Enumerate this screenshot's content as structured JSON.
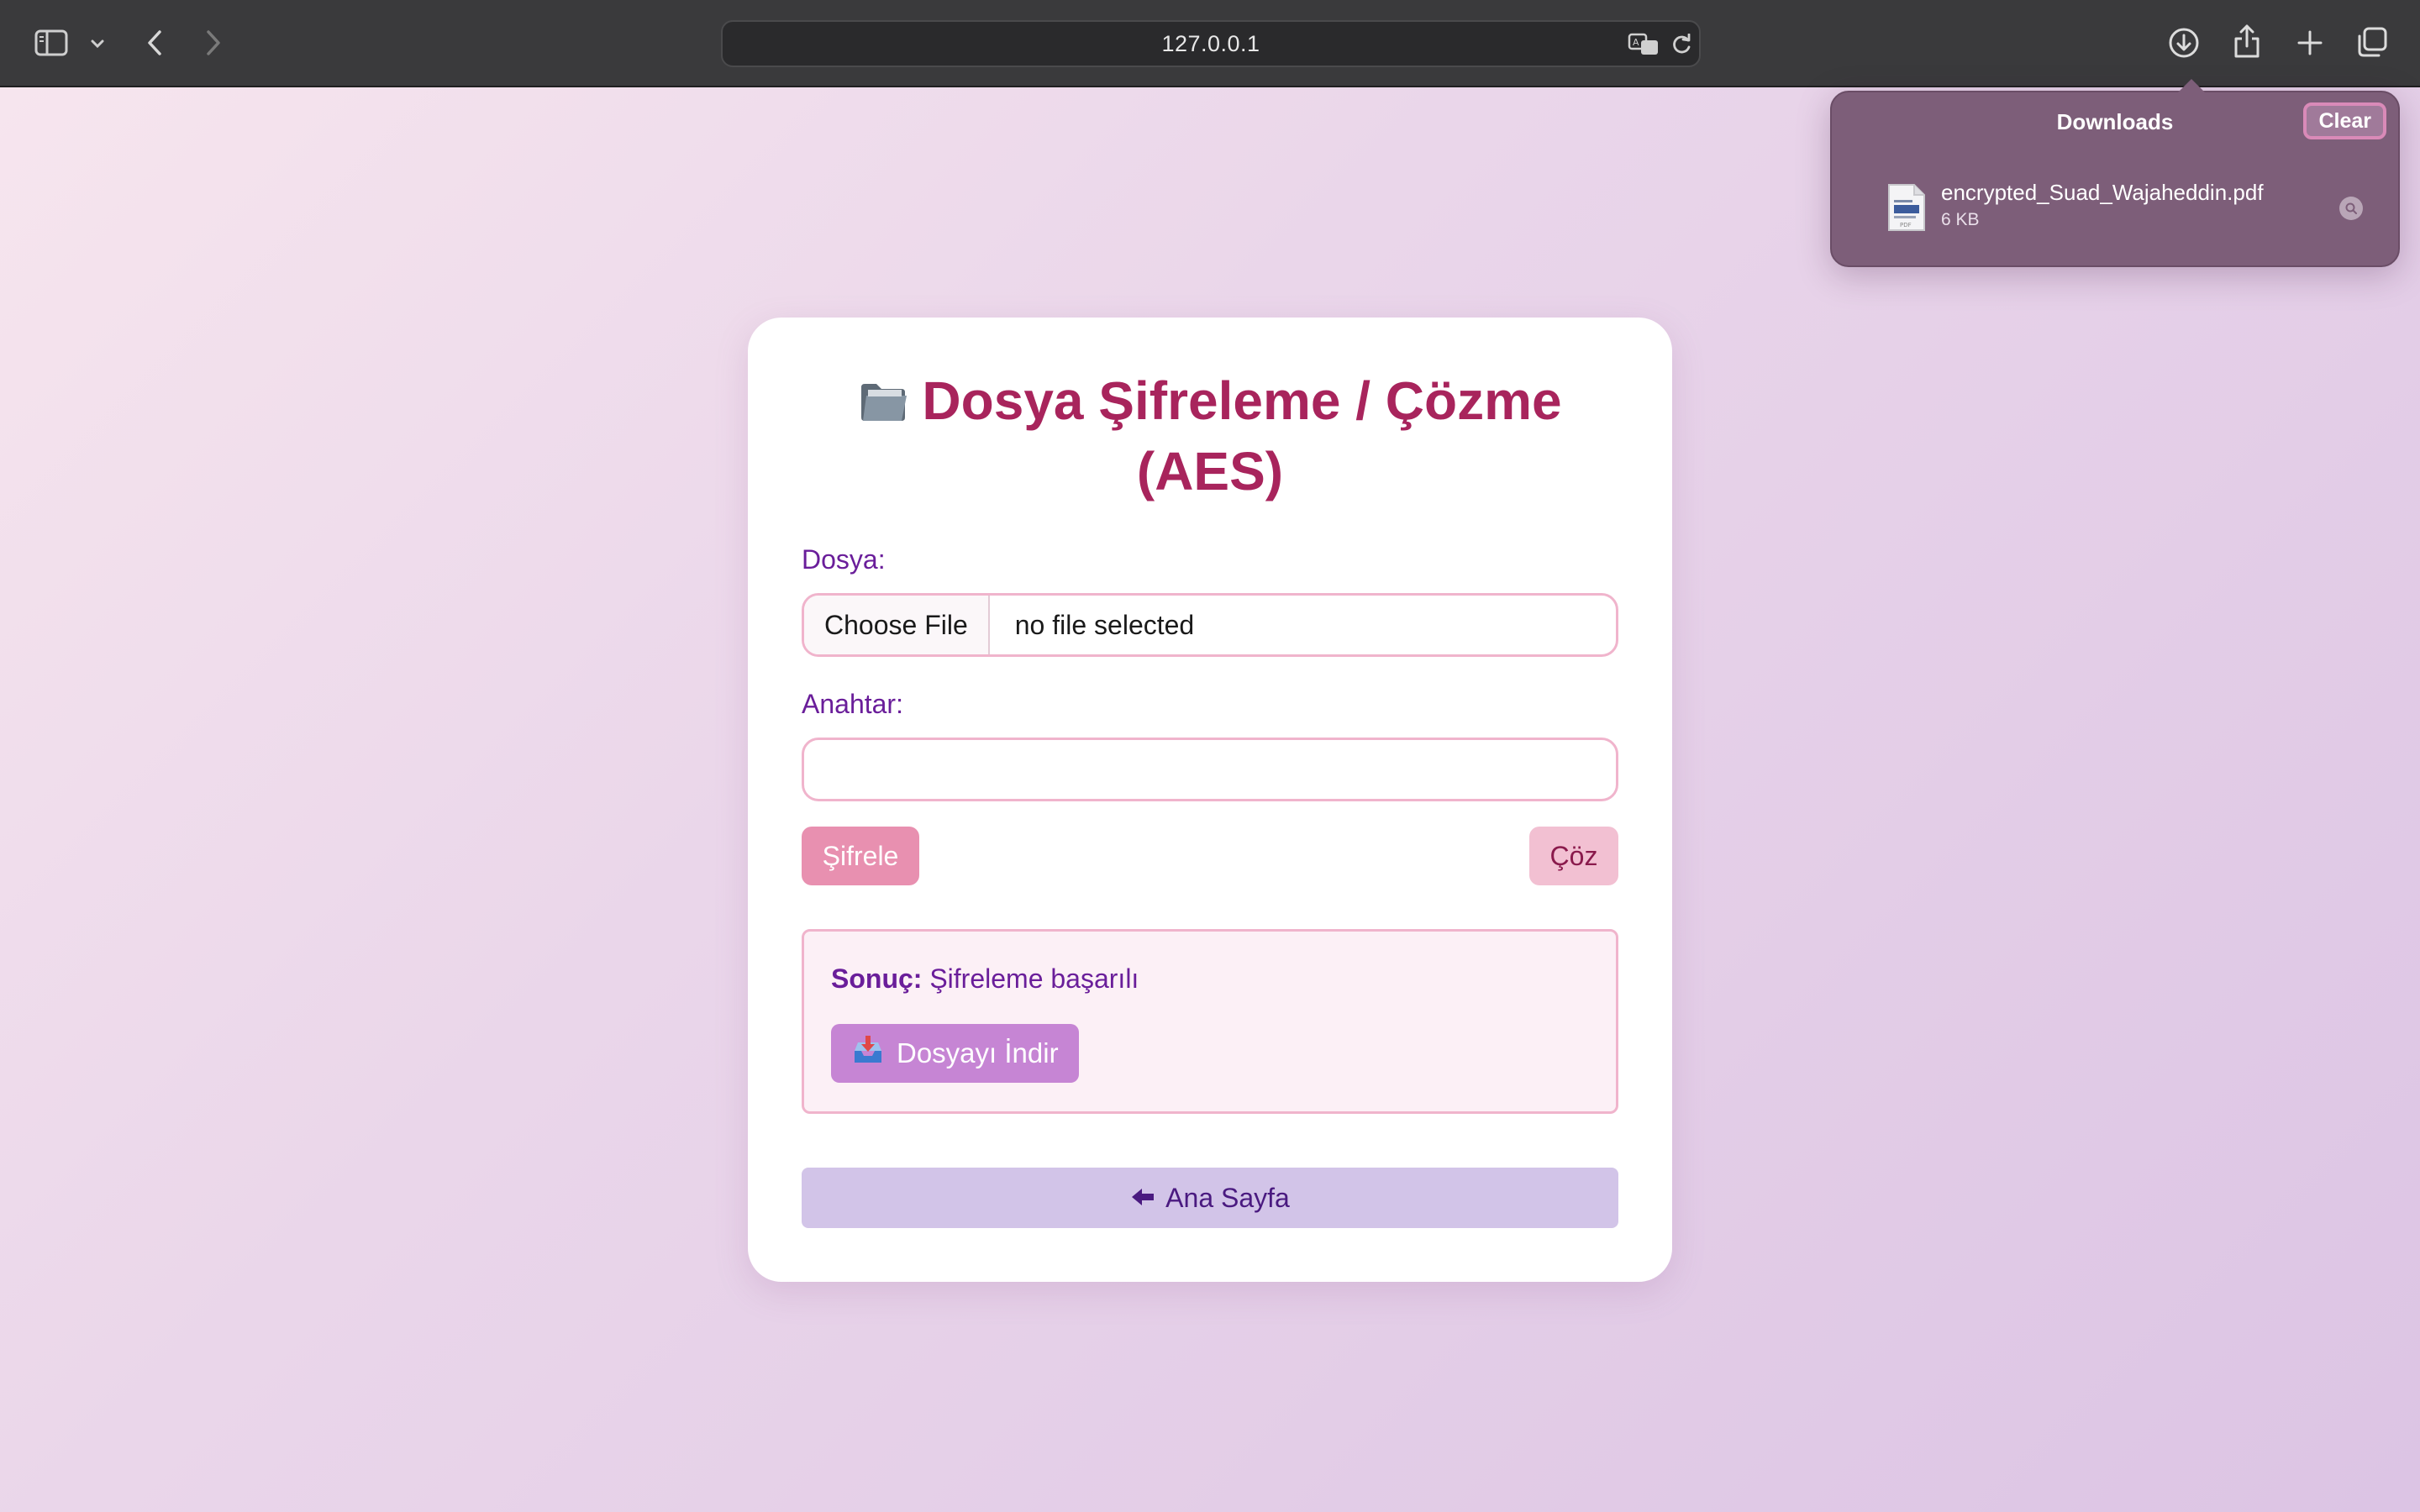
{
  "browser": {
    "url": "127.0.0.1"
  },
  "downloads": {
    "title": "Downloads",
    "clear_label": "Clear",
    "items": [
      {
        "name": "encrypted_Suad_Wajaheddin.pdf",
        "size": "6 KB"
      }
    ]
  },
  "page": {
    "title": "Dosya Şifreleme / Çözme (AES)",
    "file_label": "Dosya:",
    "choose_file_label": "Choose File",
    "file_status": "no file selected",
    "key_label": "Anahtar:",
    "key_value": "",
    "encrypt_label": "Şifrele",
    "decrypt_label": "Çöz",
    "result_label": "Sonuç:",
    "result_text": "Şifreleme başarılı",
    "download_label": "Dosyayı İndir",
    "home_label": "Ana Sayfa"
  },
  "colors": {
    "title": "#a8245c",
    "label": "#6a1e9a",
    "encrypt_button": "#e890b0",
    "decrypt_button": "#f2c0d2",
    "download_button": "#c685d4",
    "home_button": "#d2c4e8"
  },
  "icons": [
    "sidebar-icon",
    "chevron-down-icon",
    "back-icon",
    "forward-icon",
    "translate-icon",
    "reload-icon",
    "downloads-icon",
    "share-icon",
    "new-tab-icon",
    "tabs-overview-icon",
    "pdf-file-icon",
    "magnifier-icon",
    "folder-icon",
    "inbox-tray-icon",
    "left-arrow-icon"
  ]
}
